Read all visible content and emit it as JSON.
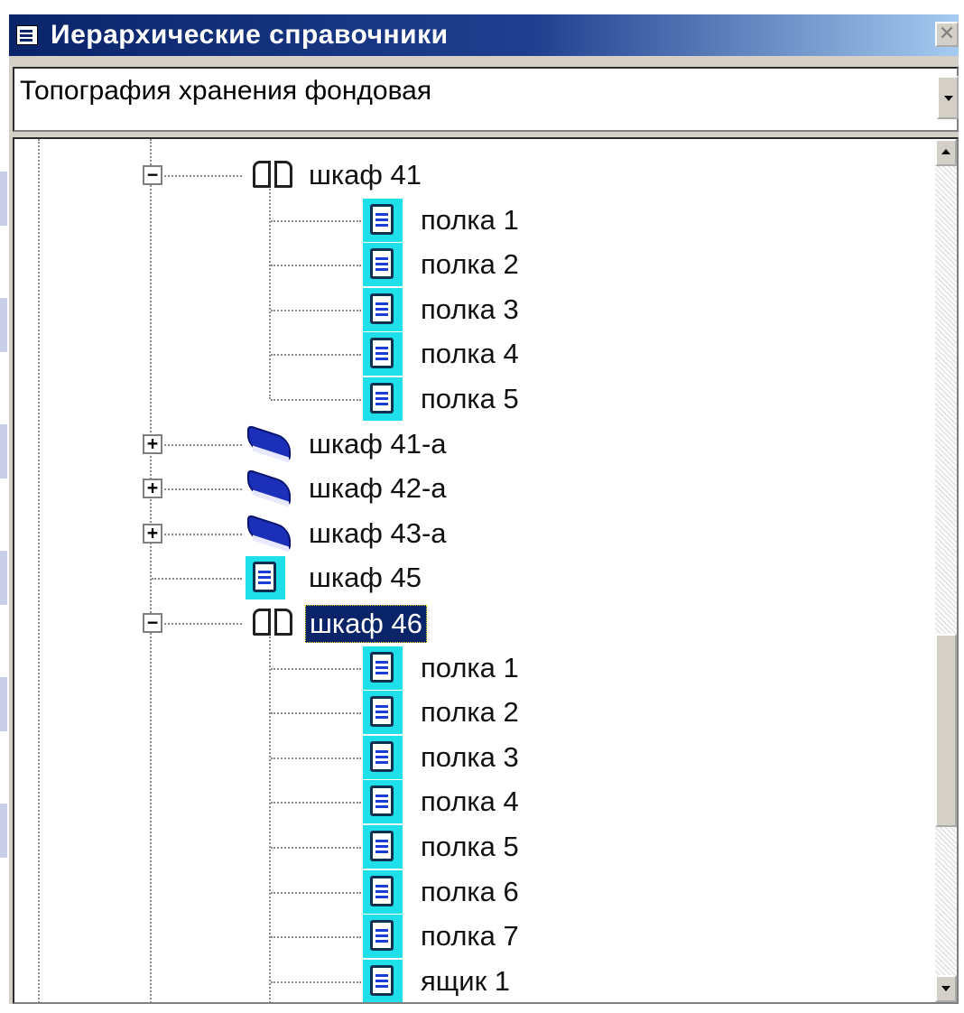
{
  "window": {
    "title": "Иерархические справочники",
    "close_glyph": "✕"
  },
  "combo": {
    "selected": "Топография хранения фондовая"
  },
  "tree": {
    "nodes": [
      {
        "label": "шкаф 41",
        "level": 1,
        "icon": "open-book-icon",
        "expander": "minus"
      },
      {
        "label": "полка 1",
        "level": 2,
        "icon": "document-icon"
      },
      {
        "label": "полка 2",
        "level": 2,
        "icon": "document-icon"
      },
      {
        "label": "полка 3",
        "level": 2,
        "icon": "document-icon"
      },
      {
        "label": "полка 4",
        "level": 2,
        "icon": "document-icon"
      },
      {
        "label": "полка 5",
        "level": 2,
        "icon": "document-icon"
      },
      {
        "label": "шкаф 41-а",
        "level": 1,
        "icon": "closed-book-icon",
        "expander": "plus"
      },
      {
        "label": "шкаф 42-а",
        "level": 1,
        "icon": "closed-book-icon",
        "expander": "plus"
      },
      {
        "label": "шкаф 43-а",
        "level": 1,
        "icon": "closed-book-icon",
        "expander": "plus"
      },
      {
        "label": "шкаф 45",
        "level": 1,
        "icon": "document-icon"
      },
      {
        "label": "шкаф 46",
        "level": 1,
        "icon": "open-book-icon",
        "expander": "minus",
        "selected": true
      },
      {
        "label": "полка 1",
        "level": 2,
        "icon": "document-icon"
      },
      {
        "label": "полка 2",
        "level": 2,
        "icon": "document-icon"
      },
      {
        "label": "полка 3",
        "level": 2,
        "icon": "document-icon"
      },
      {
        "label": "полка 4",
        "level": 2,
        "icon": "document-icon"
      },
      {
        "label": "полка 5",
        "level": 2,
        "icon": "document-icon"
      },
      {
        "label": "полка 6",
        "level": 2,
        "icon": "document-icon"
      },
      {
        "label": "полка 7",
        "level": 2,
        "icon": "document-icon"
      },
      {
        "label": "ящик 1",
        "level": 2,
        "icon": "document-icon"
      }
    ]
  },
  "colors": {
    "title_bar": "#0a246a",
    "selection": "#0a246a",
    "doc_icon_highlight": "#1fe0e8",
    "book_blue": "#1b2fb8"
  }
}
